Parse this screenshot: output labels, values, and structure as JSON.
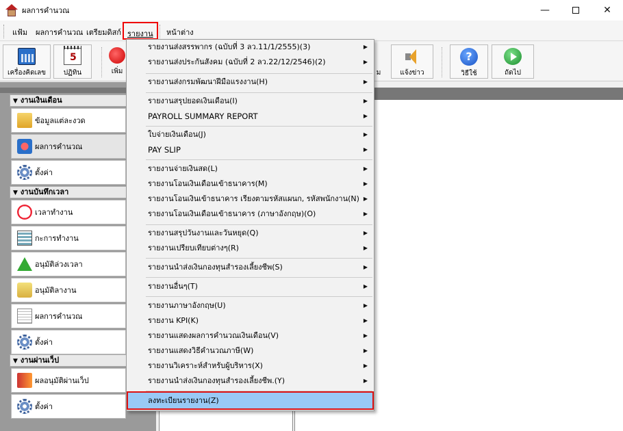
{
  "window": {
    "title": "ผลการคำนวณ",
    "minimize_glyph": "—",
    "close_glyph": "✕"
  },
  "menubar": {
    "items": [
      "แฟ้ม",
      "ผลการคำนวณ",
      "เตรียมดิสก์",
      "รายงาน",
      "หน้าต่าง"
    ],
    "active_item": "รายงาน"
  },
  "toolbar": {
    "buttons": [
      {
        "label": "เครื่องคิดเลข",
        "icon": "calculator-icon"
      },
      {
        "label": "ปฏิทิน",
        "icon": "calendar-icon"
      },
      {
        "label": "เพิ่ม",
        "icon": "red-circle-icon"
      },
      {
        "label": "ม",
        "icon": "hidden-icon"
      },
      {
        "label": "แจ้งข่าว",
        "icon": "speaker-icon"
      },
      {
        "label": "วิธีใช้",
        "icon": "help-icon"
      },
      {
        "label": "ถัดไป",
        "icon": "next-icon"
      }
    ]
  },
  "sidebar": {
    "groups": [
      {
        "title": "งานเงินเดือน",
        "items": [
          "ข้อมูลแต่ละงวด",
          "ผลการคำนวณ",
          "ตั้งค่า"
        ]
      },
      {
        "title": "งานบันทึกเวลา",
        "items": [
          "เวลาทำงาน",
          "กะการทำงาน",
          "อนุมัติล่วงเวลา",
          "อนุมัติลางาน",
          "ผลการคำนวณ",
          "ตั้งค่า"
        ]
      },
      {
        "title": "งานผ่านเว็ป",
        "items": [
          "ผลอนุมัติผ่านเว็ป",
          "ตั้งค่า"
        ]
      }
    ],
    "selected": "ผลการคำนวณ"
  },
  "report_menu": {
    "items": [
      "รายงานส่งสรรพากร (ฉบับที่ 3 ลว.11/1/2555)(3)",
      "รายงานส่งประกันสังคม (ฉบับที่ 2 ลว.22/12/2546)(2)",
      "รายงานส่งกรมพัฒนาฝีมือแรงงาน(H)",
      "รายงานสรุปยอดเงินเดือน(I)",
      "PAYROLL SUMMARY REPORT",
      "ใบจ่ายเงินเดือน(J)",
      "PAY SLIP",
      "รายงานจ่ายเงินสด(L)",
      "รายงานโอนเงินเดือนเข้าธนาคาร(M)",
      "รายงานโอนเงินเข้าธนาคาร เรียงตามรหัสแผนก, รหัสพนักงาน(N)",
      "รายงานโอนเงินเดือนเข้าธนาคาร (ภาษาอังกฤษ)(O)",
      "รายงานสรุปวันงานและวันหยุด(Q)",
      "รายงานเปรียบเทียบต่างๆ(R)",
      "รายงานนำส่งเงินกองทุนสำรองเลี้ยงชีพ(S)",
      "รายงานอื่นๆ(T)",
      "รายงานภาษาอังกฤษ(U)",
      "รายงาน KPI(K)",
      "รายงานแสดงผลการคำนวณเงินเดือน(V)",
      "รายงานแสดงวิธีคำนวณภาษี(W)",
      "รายงานวิเคราะห์สำหรับผู้บริหาร(X)",
      "รายงานนำส่งเงินกองทุนสำรองเลี้ยงชีพ.(Y)",
      "ลงทะเบียนรายงาน(Z)"
    ],
    "highlighted": "ลงทะเบียนรายงาน(Z)",
    "highlight_color": "#99c9f5",
    "callout_color": "#dd1111"
  }
}
